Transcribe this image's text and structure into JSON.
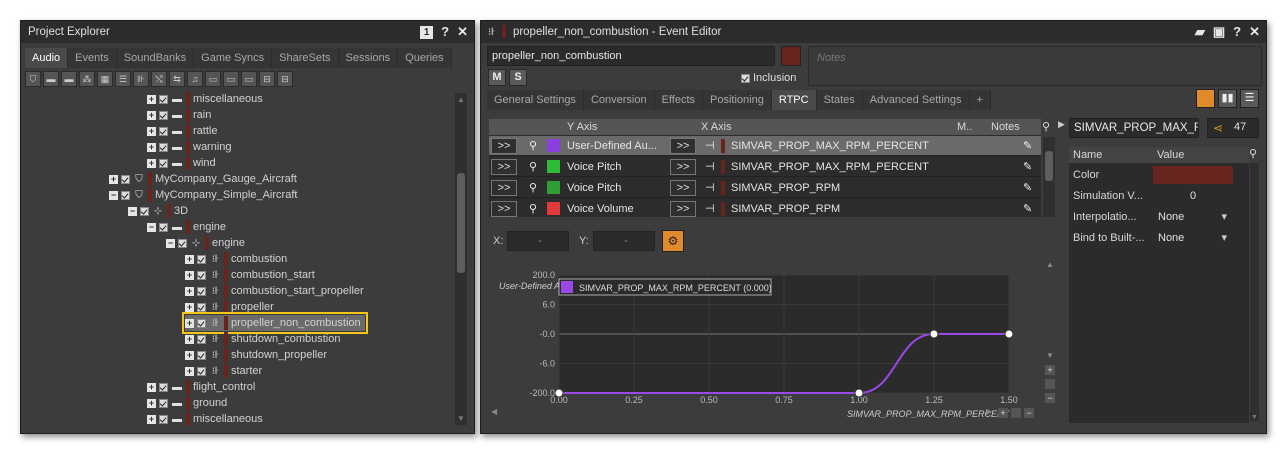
{
  "project_explorer": {
    "title": "Project Explorer",
    "title_icons": [
      "pin-1-icon",
      "help-icon",
      "close-icon"
    ],
    "tabs": [
      {
        "label": "Audio",
        "active": true
      },
      {
        "label": "Events",
        "active": false
      },
      {
        "label": "SoundBanks",
        "active": false
      },
      {
        "label": "Game Syncs",
        "active": false
      },
      {
        "label": "ShareSets",
        "active": false
      },
      {
        "label": "Sessions",
        "active": false
      },
      {
        "label": "Queries",
        "active": false
      }
    ],
    "toolbar_icons": [
      "work-unit-icon",
      "folder-icon",
      "folder-icon",
      "actor-mixer-icon",
      "grid-icon",
      "list-icon",
      "blend-icon",
      "random-icon",
      "switch-icon",
      "music-icon",
      "bus-icon",
      "bus-icon",
      "bus-icon",
      "aux-icon",
      "aux-icon"
    ],
    "tree": [
      {
        "label": "miscellaneous",
        "depth": 2,
        "icon": "folder-icon"
      },
      {
        "label": "rain",
        "depth": 2,
        "icon": "folder-icon"
      },
      {
        "label": "rattle",
        "depth": 2,
        "icon": "folder-icon"
      },
      {
        "label": "warning",
        "depth": 2,
        "icon": "folder-icon"
      },
      {
        "label": "wind",
        "depth": 2,
        "icon": "folder-icon"
      },
      {
        "label": "MyCompany_Gauge_Aircraft",
        "depth": 0,
        "icon": "work-unit-icon"
      },
      {
        "label": "MyCompany_Simple_Aircraft",
        "depth": 0,
        "icon": "work-unit-icon"
      },
      {
        "label": "3D",
        "depth": 1,
        "icon": "actor-mixer-icon"
      },
      {
        "label": "engine",
        "depth": 2,
        "icon": "folder-icon"
      },
      {
        "label": "engine",
        "depth": 3,
        "icon": "actor-mixer-icon"
      },
      {
        "label": "combustion",
        "depth": 4,
        "icon": "event-icon"
      },
      {
        "label": "combustion_start",
        "depth": 4,
        "icon": "event-icon"
      },
      {
        "label": "combustion_start_propeller",
        "depth": 4,
        "icon": "event-icon"
      },
      {
        "label": "propeller",
        "depth": 4,
        "icon": "event-icon"
      },
      {
        "label": "propeller_non_combustion",
        "depth": 4,
        "icon": "event-icon",
        "highlighted": true
      },
      {
        "label": "shutdown_combustion",
        "depth": 4,
        "icon": "event-icon"
      },
      {
        "label": "shutdown_propeller",
        "depth": 4,
        "icon": "event-icon"
      },
      {
        "label": "starter",
        "depth": 4,
        "icon": "event-icon"
      },
      {
        "label": "flight_control",
        "depth": 2,
        "icon": "folder-icon"
      },
      {
        "label": "ground",
        "depth": 2,
        "icon": "folder-icon"
      },
      {
        "label": "miscellaneous",
        "depth": 2,
        "icon": "folder-icon"
      }
    ]
  },
  "event_editor": {
    "title": "propeller_non_combustion - Event Editor",
    "name_value": "propeller_non_combustion",
    "notes_placeholder": "Notes",
    "m_label": "M",
    "s_label": "S",
    "inclusion_label": "Inclusion",
    "tabs": [
      {
        "label": "General Settings",
        "active": false
      },
      {
        "label": "Conversion",
        "active": false
      },
      {
        "label": "Effects",
        "active": false
      },
      {
        "label": "Positioning",
        "active": false
      },
      {
        "label": "RTPC",
        "active": true
      },
      {
        "label": "States",
        "active": false
      },
      {
        "label": "Advanced Settings",
        "active": false
      },
      {
        "label": "+",
        "active": false
      }
    ],
    "grid": {
      "col_y": "Y Axis",
      "col_x": "X Axis",
      "col_m": "M..",
      "col_notes": "Notes",
      "rows": [
        {
          "btn": ">>",
          "y": "User-Defined Au...",
          "x": "SIMVAR_PROP_MAX_RPM_PERCENT",
          "color": "#8a3fe0",
          "selected": true
        },
        {
          "btn": ">>",
          "y": "Voice Pitch",
          "x": "SIMVAR_PROP_MAX_RPM_PERCENT",
          "color": "#2fba3a",
          "selected": false
        },
        {
          "btn": ">>",
          "y": "Voice Pitch",
          "x": "SIMVAR_PROP_RPM",
          "color": "#2f9e37",
          "selected": false
        },
        {
          "btn": ">>",
          "y": "Voice Volume",
          "x": "SIMVAR_PROP_RPM",
          "color": "#e03a3a",
          "selected": false
        }
      ]
    },
    "x_label": "X:",
    "y_label": "Y:",
    "x_value": "-",
    "y_value": "-",
    "graph": {
      "y_axis_title": "User-Defined A",
      "legend": "SIMVAR_PROP_MAX_RPM_PERCENT  (0.000)",
      "x_axis_title": "SIMVAR_PROP_MAX_RPM_PERCENT"
    },
    "chart_data": {
      "type": "line",
      "x": [
        0.0,
        1.0,
        1.25,
        1.5
      ],
      "y": [
        -200.0,
        -200.0,
        -0.0,
        -0.0
      ],
      "xlim": [
        0.0,
        1.5
      ],
      "x_ticks": [
        "0.00",
        "0.25",
        "0.50",
        "0.75",
        "1.00",
        "1.25",
        "1.50"
      ],
      "y_ticks": [
        "200.0",
        "6.0",
        "-0.0",
        "-6.0",
        "-200.0"
      ],
      "color": "#9a48e6"
    },
    "properties": {
      "search_value": "SIMVAR_PROP_MAX_RI",
      "share_count": "47",
      "col_name": "Name",
      "col_value": "Value",
      "rows": [
        {
          "name": "Color",
          "value": ""
        },
        {
          "name": "Simulation V...",
          "value": "0"
        },
        {
          "name": "Interpolatio...",
          "value": "None"
        },
        {
          "name": "Bind to Built-...",
          "value": "None"
        }
      ]
    }
  },
  "colors": {
    "highlight": "#f5c518",
    "accent_orange": "#e08a2c",
    "curve": "#9a48e6"
  }
}
